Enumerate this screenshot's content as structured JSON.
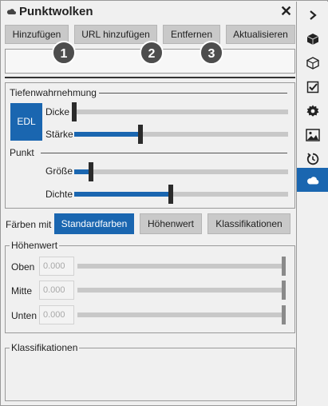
{
  "window": {
    "title": "Punktwolken",
    "close_glyph": "✕"
  },
  "toolbar": {
    "add": "Hinzufügen",
    "add_url": "URL hinzufügen",
    "remove": "Entfernen",
    "refresh": "Aktualisieren"
  },
  "markers": [
    "1",
    "2",
    "3"
  ],
  "depth": {
    "group_label": "Tiefenwahrnehmung",
    "edl_label": "EDL",
    "thickness_label": "Dicke",
    "strength_label": "Stärke",
    "thickness_value": 0.0,
    "strength_value": 0.31
  },
  "point": {
    "group_label": "Punkt",
    "size_label": "Größe",
    "density_label": "Dichte",
    "size_value": 0.08,
    "density_value": 0.45
  },
  "coloring": {
    "label": "Färben mit",
    "options": [
      "Standardfarben",
      "Höhenwert",
      "Klassifikationen"
    ],
    "selected": "Standardfarben"
  },
  "height": {
    "group_label": "Höhenwert",
    "rows": [
      {
        "label": "Oben",
        "value": "0.000"
      },
      {
        "label": "Mitte",
        "value": "0.000"
      },
      {
        "label": "Unten",
        "value": "0.000"
      }
    ]
  },
  "classifications": {
    "group_label": "Klassifikationen"
  },
  "sidebar": {
    "items": [
      {
        "name": "collapse-chevron-icon"
      },
      {
        "name": "cube-solid-icon"
      },
      {
        "name": "cube-outline-icon"
      },
      {
        "name": "checklist-icon"
      },
      {
        "name": "gear-icon"
      },
      {
        "name": "image-icon"
      },
      {
        "name": "history-clock-icon"
      },
      {
        "name": "cloud-icon",
        "active": true
      }
    ]
  },
  "colors": {
    "accent": "#1a66b0",
    "marker": "#4d4d4d"
  }
}
